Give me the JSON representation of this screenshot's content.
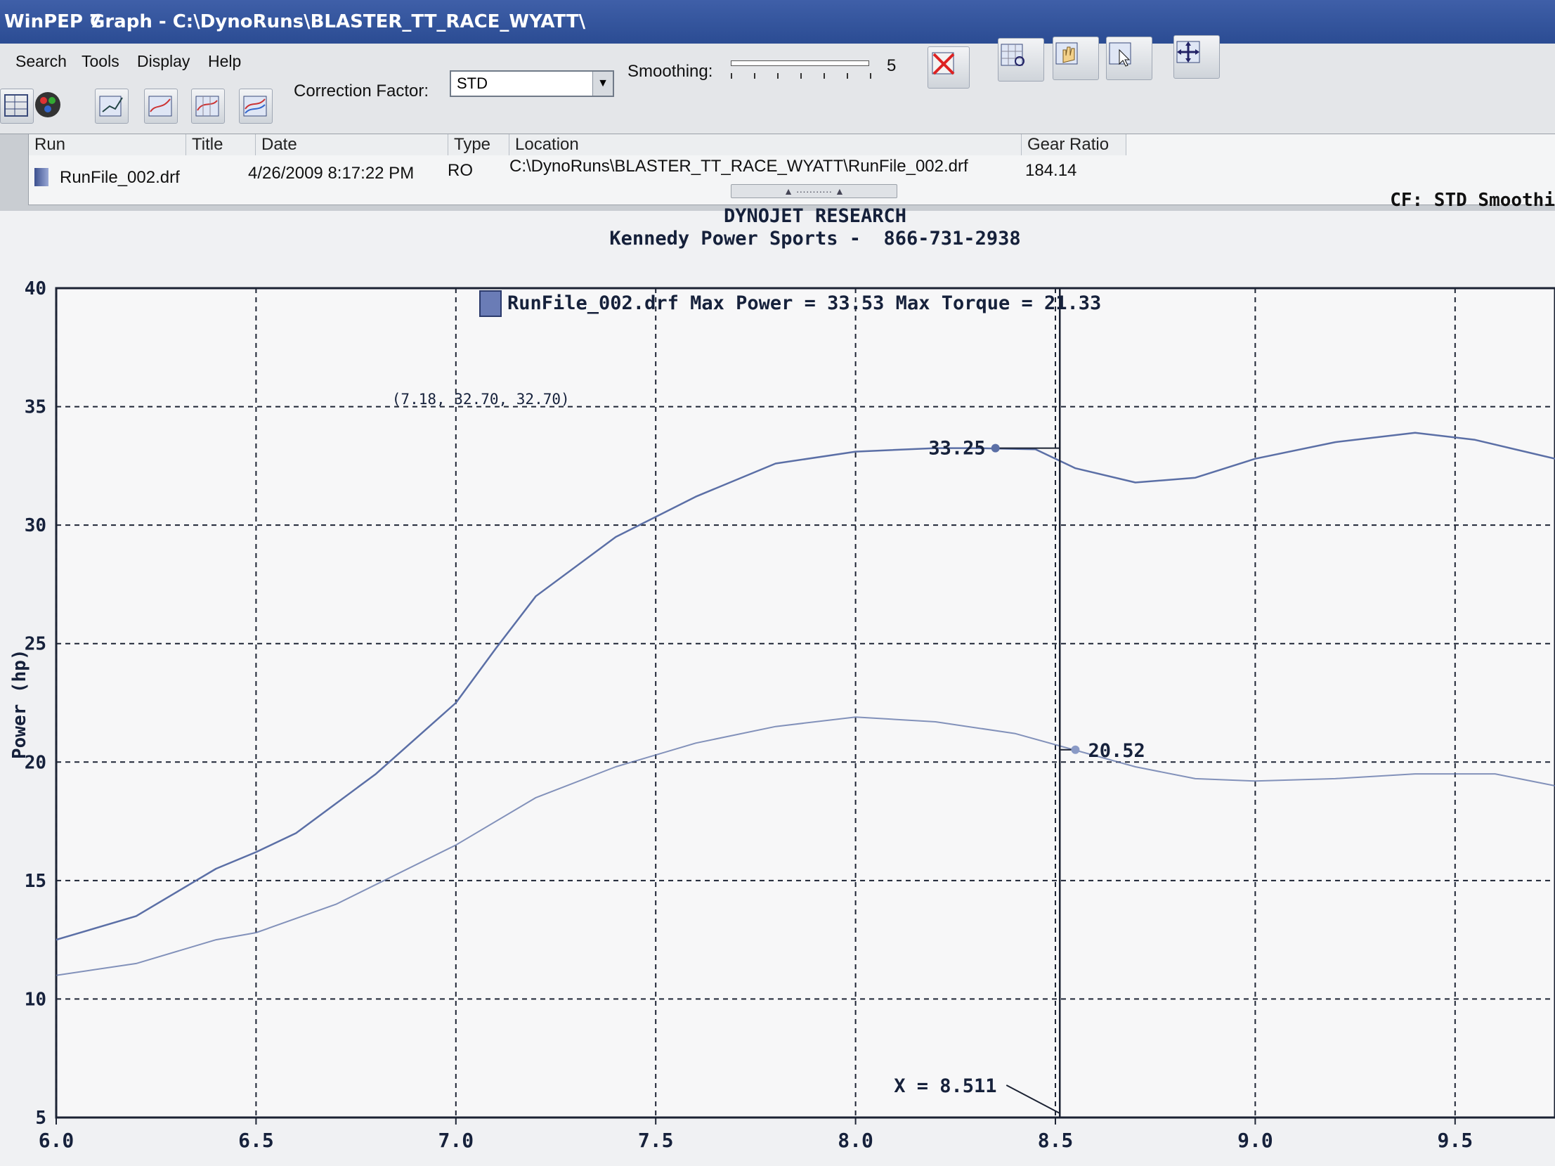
{
  "window": {
    "app_title": "WinPEP 7",
    "doc_title": "Graph - C:\\DynoRuns\\BLASTER_TT_RACE_WYATT\\"
  },
  "menu": [
    "Search",
    "Tools",
    "Display",
    "Help"
  ],
  "toolbar": {
    "correction_label": "Correction Factor:",
    "correction_value": "STD",
    "smoothing_label": "Smoothing:",
    "smoothing_value": "5",
    "icons": [
      "table-icon",
      "color-wheel-icon",
      "graph-export-icon",
      "graph-line-icon",
      "graph-grid-icon",
      "graph-multi-icon",
      "delete-icon",
      "zoom-icon",
      "pan-hand-icon",
      "cursor-select-icon",
      "move-arrows-icon"
    ]
  },
  "runlist": {
    "columns": [
      "Run",
      "Title",
      "Date",
      "Type",
      "Location",
      "Gear Ratio"
    ],
    "rows": [
      {
        "run": "RunFile_002.drf",
        "title": "",
        "date": "4/26/2009 8:17:22 PM",
        "type": "RO",
        "location": "C:\\DynoRuns\\BLASTER_TT_RACE_WYATT\\RunFile_002.drf",
        "gear_ratio": "184.14"
      }
    ]
  },
  "status": {
    "cf_label": "CF: STD  Smoothi"
  },
  "colors": {
    "plot_line": "#5b6fa6",
    "grid": "#1e2535",
    "accent": "#3f5fa8"
  },
  "chart_data": {
    "type": "line",
    "title": "DYNOJET RESEARCH",
    "subtitle": "Kennedy Power Sports -  866-731-2938",
    "legend": "RunFile_002.drf Max Power = 33.53 Max Torque = 21.33",
    "ylabel": "Power (hp)",
    "xlabel": "",
    "xlim": [
      6.0,
      9.75
    ],
    "ylim": [
      5,
      40
    ],
    "xticks": [
      "6.0",
      "6.5",
      "7.0",
      "7.5",
      "8.0",
      "8.5",
      "9.0",
      "9.5"
    ],
    "yticks": [
      "40",
      "35",
      "30",
      "25",
      "20",
      "15",
      "10",
      "5"
    ],
    "grid": true,
    "series": [
      {
        "name": "Power",
        "x": [
          6.0,
          6.2,
          6.4,
          6.5,
          6.6,
          6.8,
          7.0,
          7.1,
          7.2,
          7.4,
          7.6,
          7.8,
          8.0,
          8.2,
          8.3,
          8.45,
          8.55,
          8.7,
          8.85,
          9.0,
          9.2,
          9.4,
          9.55,
          9.75
        ],
        "y": [
          12.5,
          13.5,
          15.5,
          16.2,
          17.0,
          19.5,
          22.5,
          24.8,
          27.0,
          29.5,
          31.2,
          32.6,
          33.1,
          33.25,
          33.25,
          33.2,
          32.4,
          31.8,
          32.0,
          32.8,
          33.5,
          33.9,
          33.6,
          32.8
        ]
      },
      {
        "name": "Torque",
        "x": [
          6.0,
          6.2,
          6.4,
          6.5,
          6.7,
          7.0,
          7.2,
          7.4,
          7.6,
          7.8,
          8.0,
          8.2,
          8.4,
          8.55,
          8.7,
          8.85,
          9.0,
          9.2,
          9.4,
          9.6,
          9.75
        ],
        "y": [
          11.0,
          11.5,
          12.5,
          12.8,
          14.0,
          16.5,
          18.5,
          19.8,
          20.8,
          21.5,
          21.9,
          21.7,
          21.2,
          20.5,
          19.8,
          19.3,
          19.2,
          19.3,
          19.5,
          19.5,
          19.0
        ]
      }
    ],
    "annotations": {
      "point_label": "(7.18, 32.70, 32.70)",
      "power_cursor_value": "33.25",
      "torque_cursor_value": "20.52",
      "cursor_x_label": "X = 8.511"
    }
  }
}
